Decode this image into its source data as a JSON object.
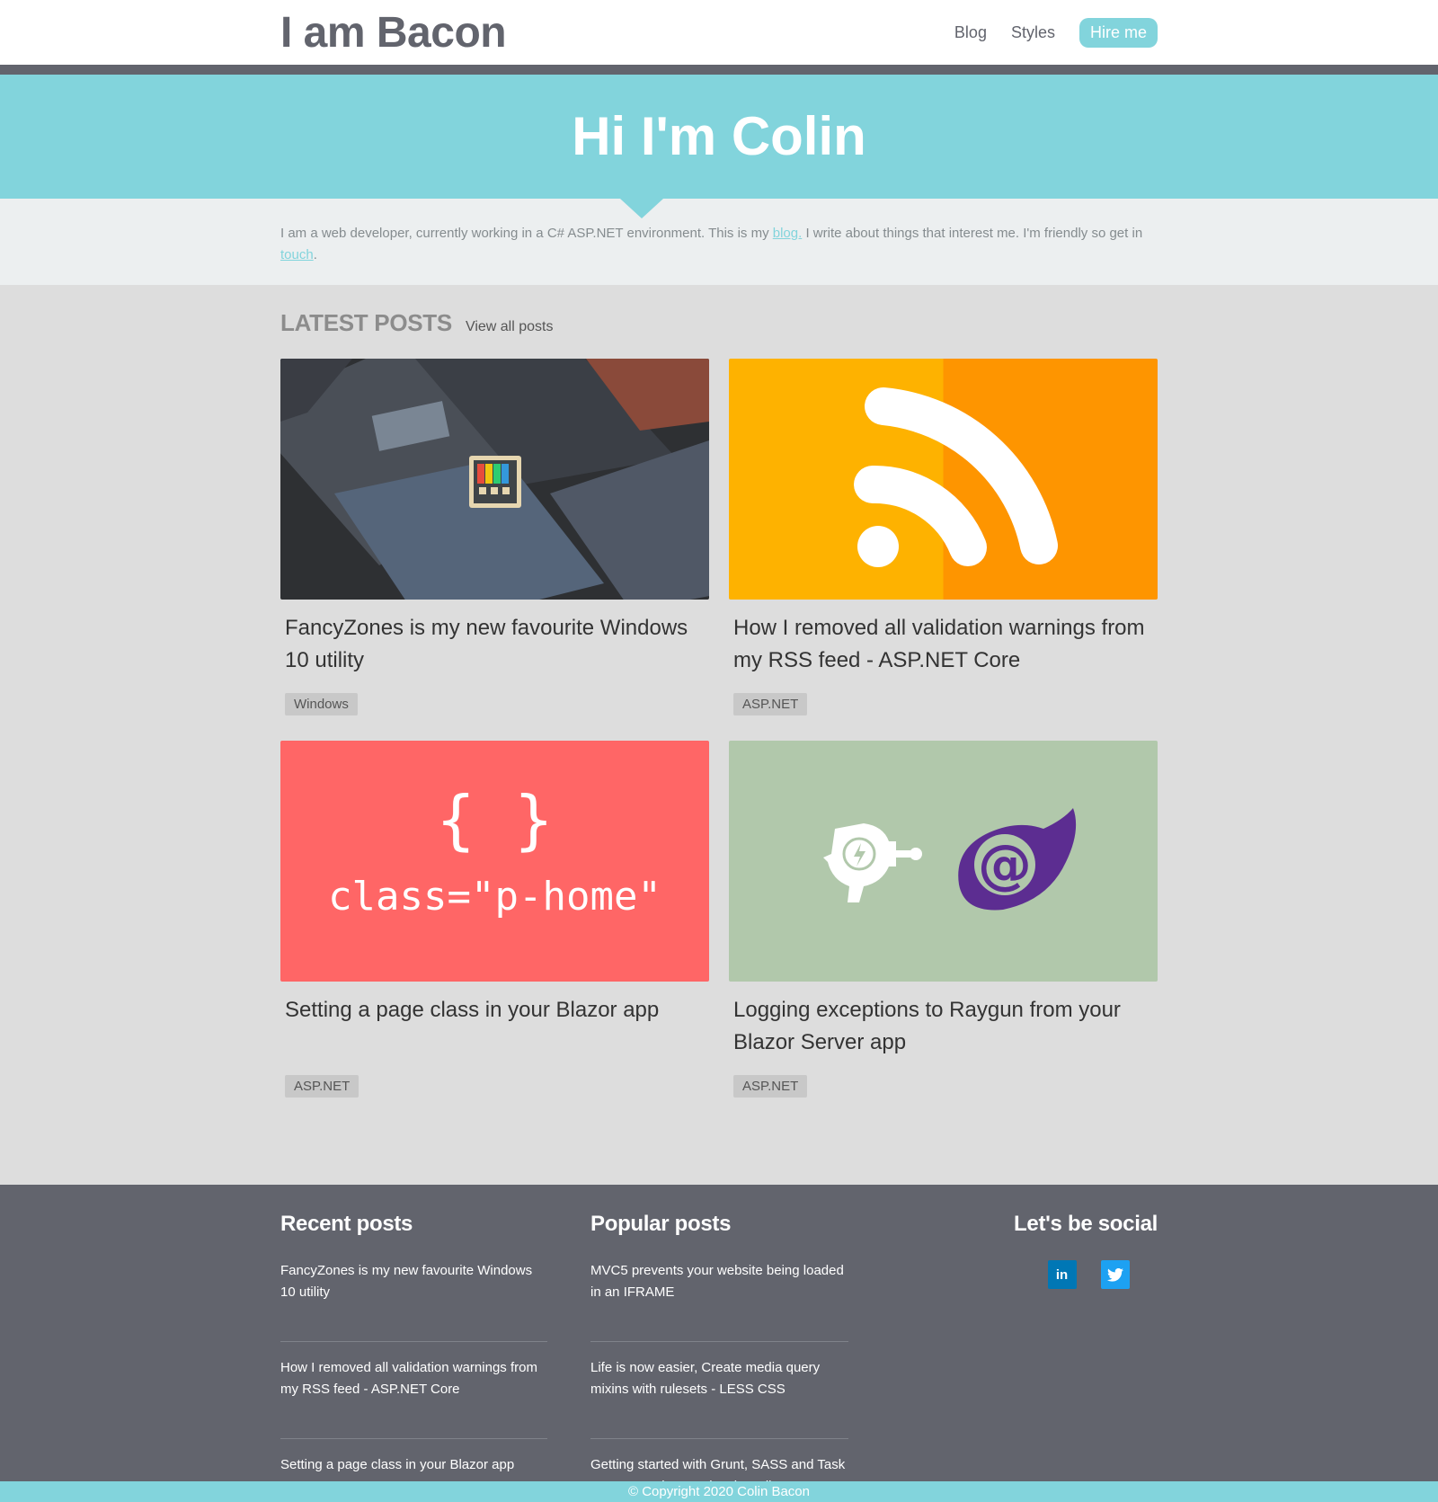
{
  "header": {
    "logo": "I am Bacon",
    "nav": {
      "blog": "Blog",
      "styles": "Styles",
      "hire": "Hire me"
    }
  },
  "hero": {
    "title": "Hi I'm Colin"
  },
  "intro": {
    "text_before": "I am a web developer, currently working in a C# ASP.NET environment. This is my ",
    "blog_link": "blog.",
    "text_middle": " I write about things that interest me. I'm friendly so get in ",
    "touch_link": "touch",
    "text_after": "."
  },
  "latest": {
    "heading": "LATEST POSTS",
    "view_all": "View all posts",
    "posts": [
      {
        "title": "FancyZones is my new favourite Windows 10 utility",
        "tag": "Windows"
      },
      {
        "title": "How I removed all validation warnings from my RSS feed - ASP.NET Core",
        "tag": "ASP.NET"
      },
      {
        "title": "Setting a page class in your Blazor app",
        "tag": "ASP.NET",
        "thumb_braces": "{ }",
        "thumb_code": "class=\"p-home\""
      },
      {
        "title": "Logging exceptions to Raygun from your Blazor Server app",
        "tag": "ASP.NET"
      }
    ]
  },
  "footer": {
    "recent_heading": "Recent posts",
    "recent": [
      "FancyZones is my new favourite Windows 10 utility",
      "How I removed all validation warnings from my RSS feed - ASP.NET Core",
      "Setting a page class in your Blazor app"
    ],
    "popular_heading": "Popular posts",
    "popular": [
      "MVC5 prevents your website being loaded in an IFRAME",
      "Life is now easier, Create media query mixins with rulesets - LESS CSS",
      "Getting started with Grunt, SASS and Task Runner Explorer - Visual Studio"
    ],
    "social_heading": "Let's be social",
    "social": {
      "linkedin": "in"
    },
    "copyright": "© Copyright 2020 Colin Bacon"
  },
  "colors": {
    "accent": "#82d4dc",
    "dark": "#62646d"
  }
}
